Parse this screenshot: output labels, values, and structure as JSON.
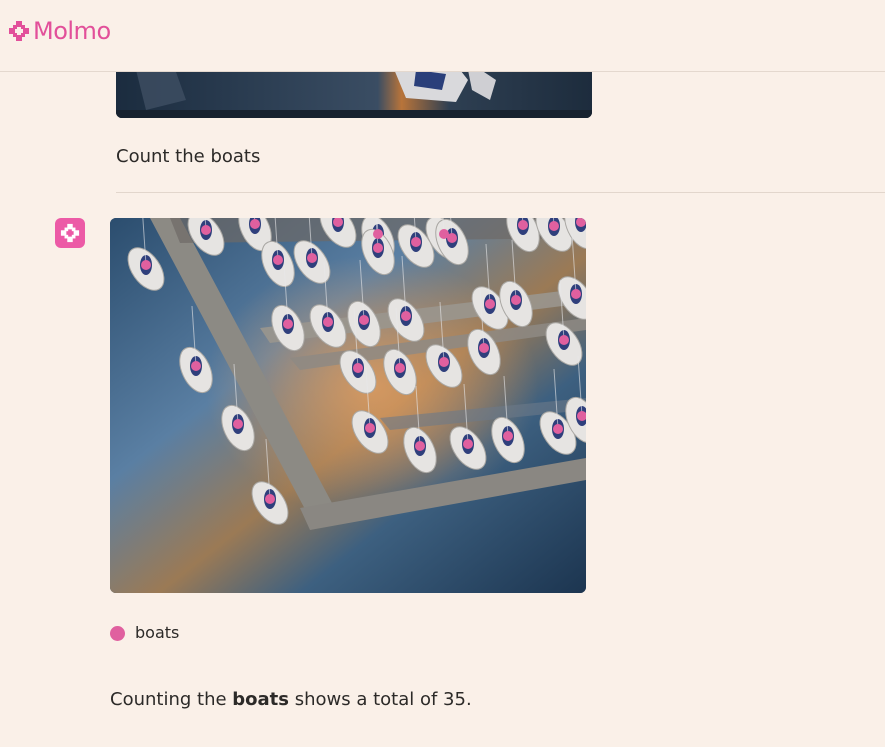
{
  "app": {
    "brand": "Molmo",
    "accent_color": "#e2509a"
  },
  "conversation": {
    "previous_image": {
      "icon": "photo-thumbnail"
    },
    "user_message": "Count the boats",
    "assistant": {
      "avatar_icon": "molmo-logo-icon",
      "image_annotation": {
        "label": "boats",
        "point_color": "#e0609f",
        "points_count": 35
      },
      "answer_prefix": "Counting the ",
      "answer_bold": "boats",
      "answer_suffix": " shows a total of 35."
    }
  }
}
